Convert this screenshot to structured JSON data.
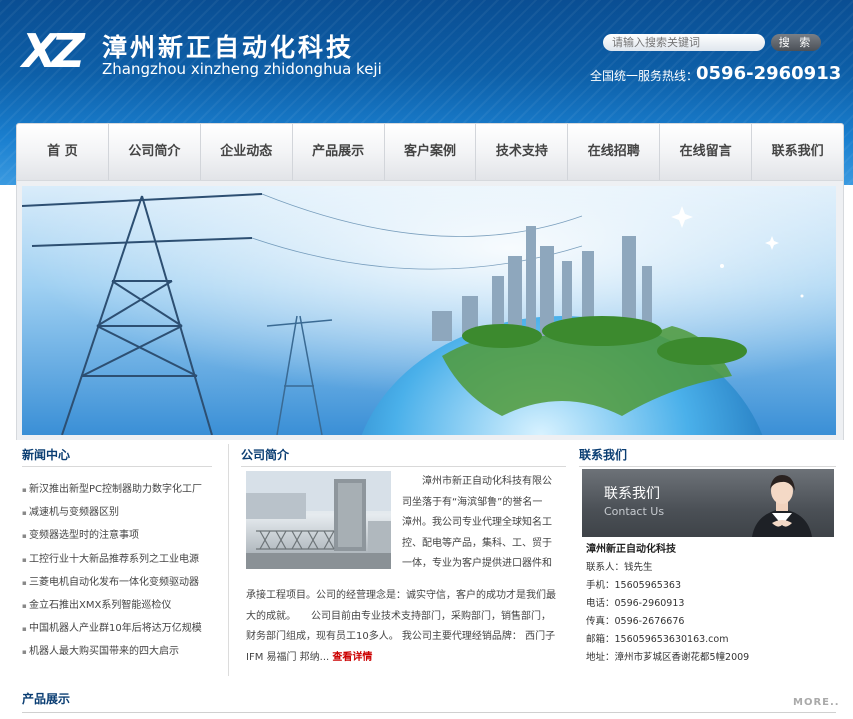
{
  "header": {
    "logo_mark": "XZ",
    "company_cn": "漳州新正自动化科技",
    "company_en": "Zhangzhou xinzheng zhidonghua keji",
    "search_placeholder": "请输入搜索关键词",
    "search_button": "搜 索",
    "hotline_label": "全国统一服务热线：",
    "hotline_number": "0596-2960913"
  },
  "nav": {
    "items": [
      "首 页",
      "公司简介",
      "企业动态",
      "产品展示",
      "客户案例",
      "技术支持",
      "在线招聘",
      "在线留言",
      "联系我们"
    ]
  },
  "news": {
    "title": "新闻中心",
    "items": [
      "新汉推出新型PC控制器助力数字化工厂",
      "减速机与变频器区别",
      "变频器选型时的注意事项",
      "工控行业十大新品推荐系列之工业电源",
      "三菱电机自动化发布一体化变频驱动器",
      "金立石推出XMX系列智能巡检仪",
      "中国机器人产业群10年后将达万亿规模",
      "机器人最大购买国带来的四大启示"
    ]
  },
  "about": {
    "title": "公司简介",
    "lines_right": [
      "漳州市新正自动化科技有限公",
      "司坐落于有“海滨邹鲁”的誉名一",
      "漳州。我公司专业代理全球知名工",
      "控、配电等产品，集科、工、贸于",
      "一体，专业为客户提供进口器件和"
    ],
    "lines_full": [
      "承接工程项目。公司的经营理念是：诚实守信，客户的成功才是我们最",
      "大的成就。　　公司目前由专业技术支持部门，采购部门，销售部门，",
      "财务部门组成，现有员工10多人。 我公司主要代理经销品牌： 西门子"
    ],
    "last_line": "IFM 易福门 邦纳... ",
    "more_label": "查看详情"
  },
  "contact": {
    "title": "联系我们",
    "banner_cn": "联系我们",
    "banner_en": "Contact Us",
    "company": "漳州新正自动化科技",
    "lines": [
      "联系人：钱先生",
      "手机：15605965363",
      "电话：0596-2960913",
      "传真：0596-2676676",
      "邮箱：156059653630163.com",
      "地址：漳州市芗城区香谢花都5幢2009"
    ]
  },
  "products": {
    "title": "产品展示",
    "more_label": "MORE.."
  },
  "colors": {
    "header_blue": "#0d5fa8",
    "title_blue": "#0b3e73",
    "link_red": "#cc0000"
  }
}
